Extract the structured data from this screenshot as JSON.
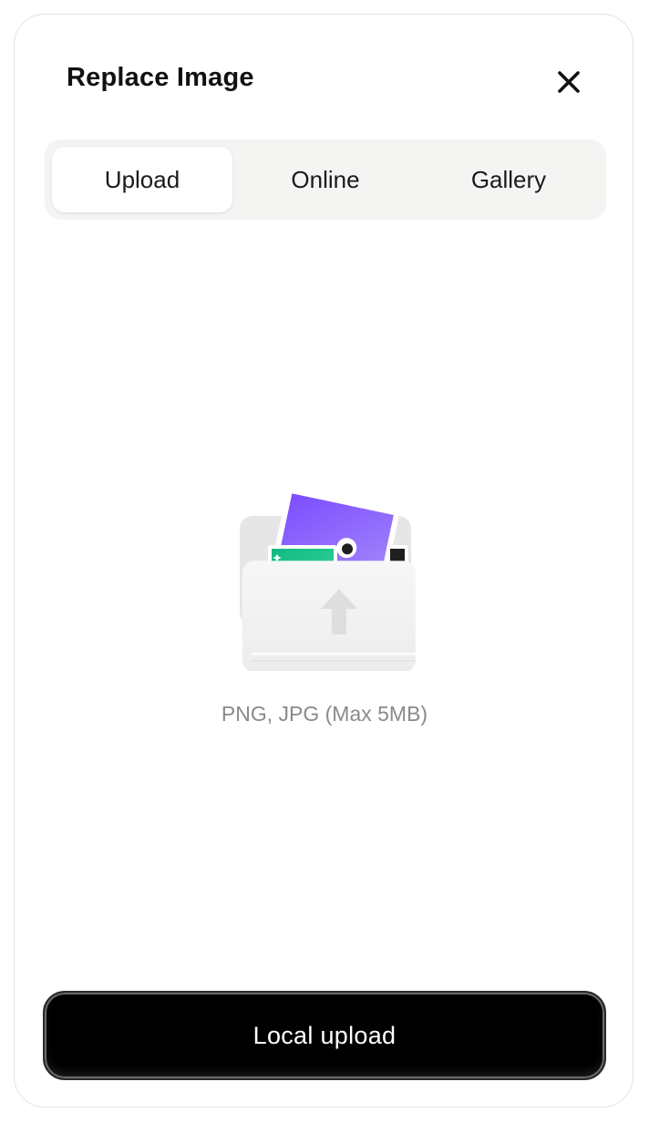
{
  "dialog": {
    "title": "Replace Image",
    "close_icon": "close-icon"
  },
  "tabs": [
    {
      "label": "Upload",
      "active": true
    },
    {
      "label": "Online",
      "active": false
    },
    {
      "label": "Gallery",
      "active": false
    }
  ],
  "upload_area": {
    "icon": "folder-upload-icon",
    "hint": "PNG, JPG (Max 5MB)"
  },
  "actions": {
    "local_upload_label": "Local upload"
  },
  "colors": {
    "primary_button": "#000000",
    "tab_bar_bg": "#f4f4f3",
    "hint_text": "#8a8a8a",
    "photo_purple": "#8b5cf6",
    "photo_green": "#22c55e"
  }
}
